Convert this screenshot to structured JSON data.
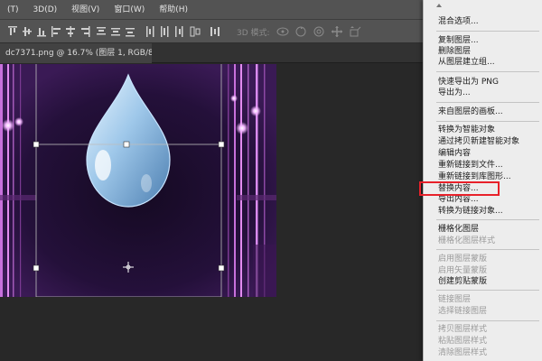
{
  "menubar": {
    "items": [
      "(T)",
      "3D(D)",
      "视图(V)",
      "窗口(W)",
      "帮助(H)"
    ]
  },
  "optionsbar": {
    "mode_label": "3D 模式:"
  },
  "document_tab": {
    "title": "dc7371.png @ 16.7% (图层 1, RGB/8)",
    "close_glyph": "×"
  },
  "context_menu": {
    "items": [
      {
        "label": "混合选项...",
        "enabled": true
      },
      {
        "label": "复制图层...",
        "enabled": true
      },
      {
        "label": "删除图层",
        "enabled": true
      },
      {
        "label": "从图层建立组...",
        "enabled": true
      },
      {
        "label": "快速导出为 PNG",
        "enabled": true
      },
      {
        "label": "导出为...",
        "enabled": true
      },
      {
        "label": "来自图层的画板...",
        "enabled": true
      },
      {
        "label": "转换为智能对象",
        "enabled": true
      },
      {
        "label": "通过拷贝新建智能对象",
        "enabled": true
      },
      {
        "label": "编辑内容",
        "enabled": true
      },
      {
        "label": "重新链接到文件...",
        "enabled": true
      },
      {
        "label": "重新链接到库图形...",
        "enabled": true
      },
      {
        "label": "替换内容...",
        "enabled": true,
        "highlighted": true
      },
      {
        "label": "导出内容...",
        "enabled": true
      },
      {
        "label": "转换为链接对象...",
        "enabled": true
      },
      {
        "label": "栅格化图层",
        "enabled": true
      },
      {
        "label": "栅格化图层样式",
        "enabled": false
      },
      {
        "label": "启用图层蒙版",
        "enabled": false
      },
      {
        "label": "启用矢量蒙版",
        "enabled": false
      },
      {
        "label": "创建剪贴蒙版",
        "enabled": true
      },
      {
        "label": "链接图层",
        "enabled": false
      },
      {
        "label": "选择链接图层",
        "enabled": false
      },
      {
        "label": "拷贝图层样式",
        "enabled": false
      },
      {
        "label": "粘贴图层样式",
        "enabled": false
      },
      {
        "label": "清除图层样式",
        "enabled": false
      }
    ]
  },
  "colors": {
    "highlight_border": "#e8212a",
    "menu_background": "#ededed",
    "canvas_background": "#1c0c28",
    "accent_glow": "#e38cf0"
  }
}
